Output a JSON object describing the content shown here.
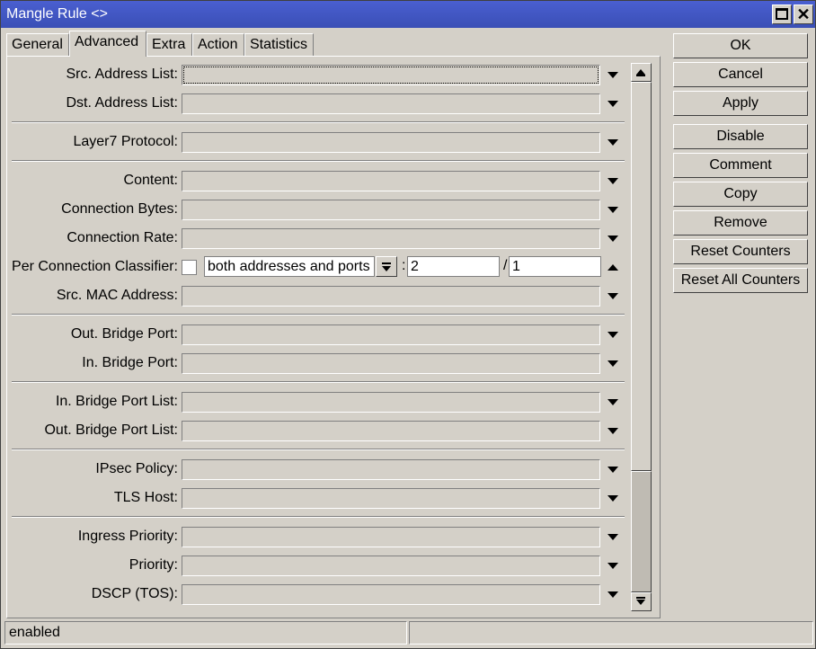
{
  "window": {
    "title": "Mangle Rule <>",
    "maximize_icon": "maximize-icon",
    "close_icon": "close-icon",
    "close_glyph": "✕"
  },
  "tabs": [
    {
      "label": "General",
      "active": false
    },
    {
      "label": "Advanced",
      "active": true
    },
    {
      "label": "Extra",
      "active": false
    },
    {
      "label": "Action",
      "active": false
    },
    {
      "label": "Statistics",
      "active": false
    }
  ],
  "fields": {
    "src_address_list": "Src. Address List:",
    "dst_address_list": "Dst. Address List:",
    "layer7_protocol": "Layer7 Protocol:",
    "content": "Content:",
    "connection_bytes": "Connection Bytes:",
    "connection_rate": "Connection Rate:",
    "per_connection_classifier": "Per Connection Classifier:",
    "src_mac_address": "Src. MAC Address:",
    "out_bridge_port": "Out. Bridge Port:",
    "in_bridge_port": "In. Bridge Port:",
    "in_bridge_port_list": "In. Bridge Port List:",
    "out_bridge_port_list": "Out. Bridge Port List:",
    "ipsec_policy": "IPsec Policy:",
    "tls_host": "TLS Host:",
    "ingress_priority": "Ingress Priority:",
    "priority": "Priority:",
    "dscp_tos": "DSCP (TOS):"
  },
  "per_connection_classifier": {
    "checked": false,
    "mode": "both addresses and ports",
    "every": "2",
    "offset": "1",
    "sep_colon": ":",
    "sep_slash": "/"
  },
  "buttons": {
    "ok": "OK",
    "cancel": "Cancel",
    "apply": "Apply",
    "disable": "Disable",
    "comment": "Comment",
    "copy": "Copy",
    "remove": "Remove",
    "reset_counters": "Reset Counters",
    "reset_all_counters": "Reset All Counters"
  },
  "status": {
    "left": "enabled",
    "right": ""
  },
  "colors": {
    "titlebar": "#3a4fb6",
    "window_bg": "#d4d0c8"
  }
}
